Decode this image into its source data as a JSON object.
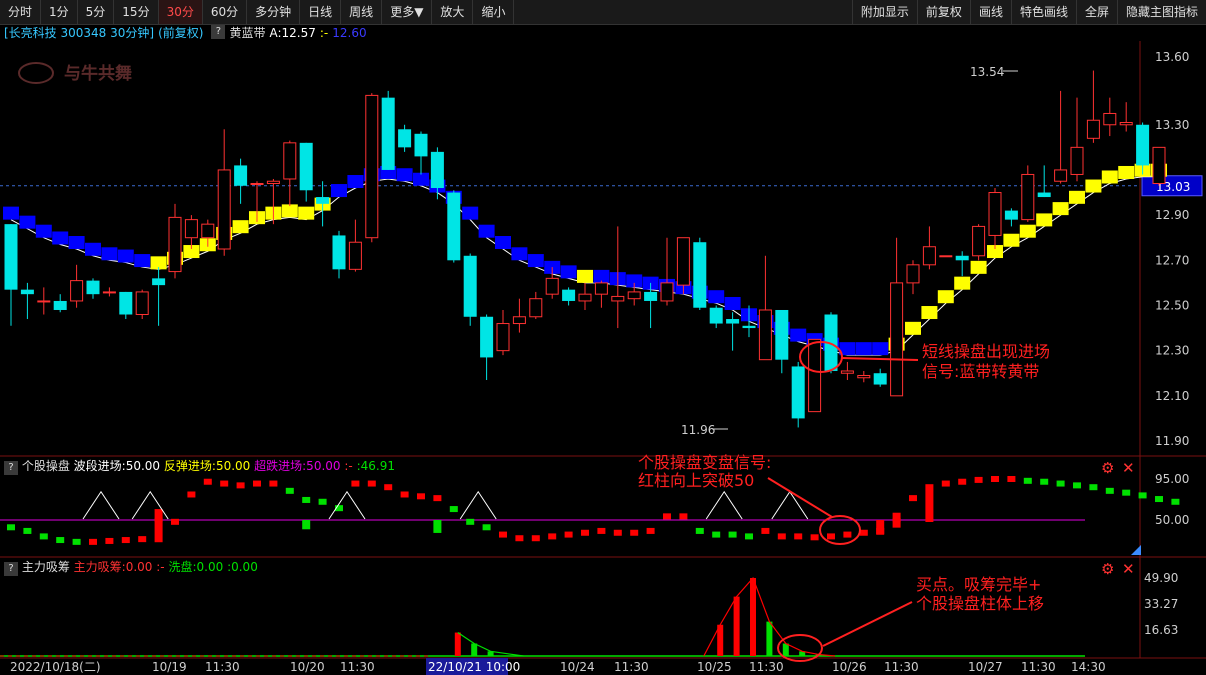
{
  "toolbar": {
    "left": [
      "分时",
      "1分",
      "5分",
      "15分",
      "30分",
      "60分",
      "多分钟",
      "日线",
      "周线",
      "更多▼",
      "放大",
      "缩小"
    ],
    "active": "30分",
    "right": [
      "附加显示",
      "前复权",
      "画线",
      "特色画线",
      "全屏",
      "隐藏主图指标"
    ]
  },
  "info": {
    "stock": "[长亮科技 300348 30分钟]",
    "adjust": "(前复权)",
    "indicator": "黄蓝带",
    "a_label": "A:12.57",
    "a_sep": ":-",
    "a_value": "12.60"
  },
  "watermark": "与牛共舞",
  "price_axis": [
    "13.60",
    "13.30",
    "13.03",
    "12.90",
    "12.70",
    "12.50",
    "12.30",
    "12.10",
    "11.90"
  ],
  "price_axis_colors": {
    "current": "#0000c8",
    "current_text": "#ffffff"
  },
  "marks": {
    "high": "13.54",
    "low": "11.96"
  },
  "annotations": {
    "a1_line1": "短线操盘出现进场",
    "a1_line2": "信号:蓝带转黄带",
    "a2_line1": "个股操盘变盘信号:",
    "a2_line2": "红柱向上突破50",
    "a3_line1": "买点。吸筹完毕+",
    "a3_line2": "个股操盘柱体上移"
  },
  "ind1": {
    "name": "个股操盘",
    "l1": "波段进场:50.00",
    "l2": "反弹进场:50.00",
    "l3": "超跌进场:50.00",
    "l4": ":-",
    "l5": ":46.91",
    "axis": [
      "95.00",
      "50.00"
    ]
  },
  "ind2": {
    "name": "主力吸筹",
    "l1": "主力吸筹:0.00",
    "l2": ":-",
    "l3": "洗盘:0.00",
    "l4": ":0.00",
    "axis": [
      "49.90",
      "33.27",
      "16.63"
    ]
  },
  "time_axis": [
    "2022/10/18(二)",
    "10/19",
    "11:30",
    "10/20",
    "11:30",
    "22/10/21 10:00",
    "10/24",
    "11:30",
    "10/25",
    "11:30",
    "10/26",
    "11:30",
    "10/27",
    "11:30",
    "14:30"
  ],
  "colors": {
    "up": "#ff3232",
    "down": "#00e5e5",
    "band_yellow": "#ffff00",
    "band_blue": "#0000ff",
    "ind_red": "#ff0000",
    "ind_green": "#00e000",
    "magenta": "#e000e0",
    "annot": "#ff2020"
  },
  "chart_data": {
    "type": "candlestick",
    "price_range": [
      11.83,
      13.68
    ],
    "candles": [
      {
        "o": 12.86,
        "c": 12.57,
        "h": 12.86,
        "l": 12.41
      },
      {
        "o": 12.57,
        "c": 12.55,
        "h": 12.6,
        "l": 12.44
      },
      {
        "o": 12.52,
        "c": 12.52,
        "h": 12.58,
        "l": 12.46
      },
      {
        "o": 12.52,
        "c": 12.48,
        "h": 12.55,
        "l": 12.47
      },
      {
        "o": 12.52,
        "c": 12.61,
        "h": 12.68,
        "l": 12.49
      },
      {
        "o": 12.61,
        "c": 12.55,
        "h": 12.62,
        "l": 12.53
      },
      {
        "o": 12.56,
        "c": 12.56,
        "h": 12.58,
        "l": 12.54
      },
      {
        "o": 12.56,
        "c": 12.46,
        "h": 12.56,
        "l": 12.44
      },
      {
        "o": 12.46,
        "c": 12.56,
        "h": 12.57,
        "l": 12.44
      },
      {
        "o": 12.62,
        "c": 12.59,
        "h": 12.67,
        "l": 12.41
      },
      {
        "o": 12.65,
        "c": 12.89,
        "h": 12.95,
        "l": 12.62
      },
      {
        "o": 12.8,
        "c": 12.88,
        "h": 12.9,
        "l": 12.75
      },
      {
        "o": 12.8,
        "c": 12.86,
        "h": 12.88,
        "l": 12.76
      },
      {
        "o": 12.75,
        "c": 13.1,
        "h": 13.28,
        "l": 12.72
      },
      {
        "o": 13.12,
        "c": 13.03,
        "h": 13.15,
        "l": 12.95
      },
      {
        "o": 13.04,
        "c": 13.04,
        "h": 13.05,
        "l": 12.87
      },
      {
        "o": 13.04,
        "c": 13.05,
        "h": 13.06,
        "l": 12.86
      },
      {
        "o": 13.06,
        "c": 13.22,
        "h": 13.23,
        "l": 12.94
      },
      {
        "o": 13.22,
        "c": 13.01,
        "h": 13.22,
        "l": 12.96
      },
      {
        "o": 12.98,
        "c": 12.95,
        "h": 13.05,
        "l": 12.85
      },
      {
        "o": 12.81,
        "c": 12.66,
        "h": 12.83,
        "l": 12.62
      },
      {
        "o": 12.66,
        "c": 12.78,
        "h": 12.88,
        "l": 12.65
      },
      {
        "o": 12.8,
        "c": 13.43,
        "h": 13.44,
        "l": 12.78
      },
      {
        "o": 13.42,
        "c": 13.1,
        "h": 13.45,
        "l": 13.1
      },
      {
        "o": 13.28,
        "c": 13.2,
        "h": 13.3,
        "l": 13.18
      },
      {
        "o": 13.26,
        "c": 13.16,
        "h": 13.27,
        "l": 13.08
      },
      {
        "o": 13.18,
        "c": 13.02,
        "h": 13.2,
        "l": 12.97
      },
      {
        "o": 13.0,
        "c": 12.7,
        "h": 13.01,
        "l": 12.69
      },
      {
        "o": 12.72,
        "c": 12.45,
        "h": 12.73,
        "l": 12.41
      },
      {
        "o": 12.45,
        "c": 12.27,
        "h": 12.46,
        "l": 12.17
      },
      {
        "o": 12.3,
        "c": 12.42,
        "h": 12.48,
        "l": 12.28
      },
      {
        "o": 12.42,
        "c": 12.45,
        "h": 12.53,
        "l": 12.38
      },
      {
        "o": 12.45,
        "c": 12.53,
        "h": 12.56,
        "l": 12.44
      },
      {
        "o": 12.55,
        "c": 12.62,
        "h": 12.67,
        "l": 12.53
      },
      {
        "o": 12.57,
        "c": 12.52,
        "h": 12.58,
        "l": 12.5
      },
      {
        "o": 12.52,
        "c": 12.55,
        "h": 12.6,
        "l": 12.48
      },
      {
        "o": 12.55,
        "c": 12.6,
        "h": 12.61,
        "l": 12.49
      },
      {
        "o": 12.52,
        "c": 12.54,
        "h": 12.85,
        "l": 12.4
      },
      {
        "o": 12.53,
        "c": 12.56,
        "h": 12.6,
        "l": 12.5
      },
      {
        "o": 12.56,
        "c": 12.52,
        "h": 12.6,
        "l": 12.4
      },
      {
        "o": 12.52,
        "c": 12.6,
        "h": 12.8,
        "l": 12.5
      },
      {
        "o": 12.59,
        "c": 12.8,
        "h": 12.8,
        "l": 12.55
      },
      {
        "o": 12.78,
        "c": 12.49,
        "h": 12.8,
        "l": 12.48
      },
      {
        "o": 12.49,
        "c": 12.42,
        "h": 12.5,
        "l": 12.4
      },
      {
        "o": 12.44,
        "c": 12.42,
        "h": 12.47,
        "l": 12.3
      },
      {
        "o": 12.41,
        "c": 12.4,
        "h": 12.5,
        "l": 12.36
      },
      {
        "o": 12.26,
        "c": 12.48,
        "h": 12.72,
        "l": 12.26
      },
      {
        "o": 12.48,
        "c": 12.26,
        "h": 12.48,
        "l": 12.2
      },
      {
        "o": 12.23,
        "c": 12.0,
        "h": 12.25,
        "l": 11.96
      },
      {
        "o": 12.03,
        "c": 12.35,
        "h": 12.35,
        "l": 12.03
      },
      {
        "o": 12.46,
        "c": 12.21,
        "h": 12.47,
        "l": 12.2
      },
      {
        "o": 12.2,
        "c": 12.21,
        "h": 12.25,
        "l": 12.17
      },
      {
        "o": 12.18,
        "c": 12.19,
        "h": 12.21,
        "l": 12.16
      },
      {
        "o": 12.2,
        "c": 12.15,
        "h": 12.22,
        "l": 12.14
      },
      {
        "o": 12.1,
        "c": 12.6,
        "h": 12.8,
        "l": 12.1
      },
      {
        "o": 12.6,
        "c": 12.68,
        "h": 12.7,
        "l": 12.55
      },
      {
        "o": 12.68,
        "c": 12.76,
        "h": 12.85,
        "l": 12.66
      },
      {
        "o": 12.72,
        "c": 12.72,
        "h": 12.72,
        "l": 12.72
      },
      {
        "o": 12.72,
        "c": 12.7,
        "h": 12.74,
        "l": 12.63
      },
      {
        "o": 12.72,
        "c": 12.85,
        "h": 12.86,
        "l": 12.7
      },
      {
        "o": 12.81,
        "c": 13.0,
        "h": 13.02,
        "l": 12.75
      },
      {
        "o": 12.92,
        "c": 12.88,
        "h": 12.93,
        "l": 12.85
      },
      {
        "o": 12.88,
        "c": 13.08,
        "h": 13.12,
        "l": 12.87
      },
      {
        "o": 13.0,
        "c": 12.98,
        "h": 13.12,
        "l": 12.98
      },
      {
        "o": 13.05,
        "c": 13.1,
        "h": 13.45,
        "l": 13.04
      },
      {
        "o": 13.08,
        "c": 13.2,
        "h": 13.42,
        "l": 13.05
      },
      {
        "o": 13.24,
        "c": 13.32,
        "h": 13.54,
        "l": 13.22
      },
      {
        "o": 13.3,
        "c": 13.35,
        "h": 13.42,
        "l": 13.25
      },
      {
        "o": 13.3,
        "c": 13.31,
        "h": 13.4,
        "l": 13.27
      },
      {
        "o": 13.3,
        "c": 13.12,
        "h": 13.31,
        "l": 13.08
      },
      {
        "o": 13.04,
        "c": 13.2,
        "h": 13.2,
        "l": 13.03
      }
    ],
    "band": [
      12.88,
      12.84,
      12.8,
      12.77,
      12.75,
      12.72,
      12.7,
      12.69,
      12.67,
      12.66,
      12.68,
      12.71,
      12.74,
      12.79,
      12.82,
      12.86,
      12.88,
      12.89,
      12.88,
      12.92,
      12.98,
      13.02,
      13.05,
      13.06,
      13.05,
      13.03,
      13.0,
      12.95,
      12.88,
      12.8,
      12.75,
      12.7,
      12.67,
      12.64,
      12.62,
      12.6,
      12.6,
      12.59,
      12.58,
      12.57,
      12.56,
      12.55,
      12.53,
      12.51,
      12.48,
      12.43,
      12.4,
      12.37,
      12.34,
      12.32,
      12.3,
      12.28,
      12.28,
      12.28,
      12.3,
      12.37,
      12.44,
      12.51,
      12.57,
      12.64,
      12.71,
      12.76,
      12.8,
      12.85,
      12.9,
      12.95,
      13.0,
      13.04,
      13.06,
      13.07,
      13.07
    ],
    "band_yellow_from_index": [
      [
        9,
        17
      ],
      [
        18,
        19
      ],
      [
        35,
        35
      ],
      [
        54,
        70
      ]
    ],
    "ind1_values": [
      42,
      38,
      32,
      28,
      26,
      26,
      27,
      28,
      29,
      30,
      48,
      78,
      92,
      90,
      88,
      90,
      90,
      82,
      72,
      70,
      63,
      90,
      90,
      86,
      78,
      76,
      74,
      62,
      48,
      42,
      34,
      30,
      30,
      32,
      34,
      36,
      38,
      36,
      36,
      38,
      54,
      54,
      38,
      34,
      34,
      32,
      38,
      32,
      32,
      31,
      32,
      34,
      36,
      38,
      46,
      74,
      86,
      90,
      92,
      94,
      95,
      95,
      93,
      92,
      90,
      88,
      86,
      82,
      80,
      77,
      73,
      70
    ],
    "ind1_red_flags": [
      0,
      0,
      0,
      0,
      0,
      1,
      1,
      1,
      1,
      1,
      1,
      1,
      1,
      1,
      1,
      1,
      1,
      0,
      0,
      0,
      0,
      1,
      1,
      1,
      1,
      1,
      1,
      0,
      0,
      0,
      1,
      1,
      1,
      1,
      1,
      1,
      1,
      1,
      1,
      1,
      1,
      1,
      0,
      0,
      0,
      0,
      1,
      1,
      1,
      1,
      1,
      1,
      1,
      1,
      1,
      1,
      1,
      1,
      1,
      1,
      1,
      1,
      0,
      0,
      0,
      0,
      0,
      0,
      0,
      0,
      0,
      0
    ],
    "ind1_triangles": [
      5,
      8,
      20,
      28,
      43,
      47
    ],
    "ind2_peaks": [
      {
        "i": 27,
        "v": 15.0,
        "c": "red"
      },
      {
        "i": 28,
        "v": 8.0,
        "c": "green"
      },
      {
        "i": 29,
        "v": 3.0,
        "c": "green"
      },
      {
        "i": 43,
        "v": 20.0,
        "c": "red"
      },
      {
        "i": 44,
        "v": 38.0,
        "c": "red"
      },
      {
        "i": 45,
        "v": 49.9,
        "c": "red"
      },
      {
        "i": 46,
        "v": 22.0,
        "c": "green"
      },
      {
        "i": 47,
        "v": 8.0,
        "c": "green"
      },
      {
        "i": 48,
        "v": 3.0,
        "c": "green"
      },
      {
        "i": 49,
        "v": 1.0,
        "c": "green"
      }
    ]
  }
}
